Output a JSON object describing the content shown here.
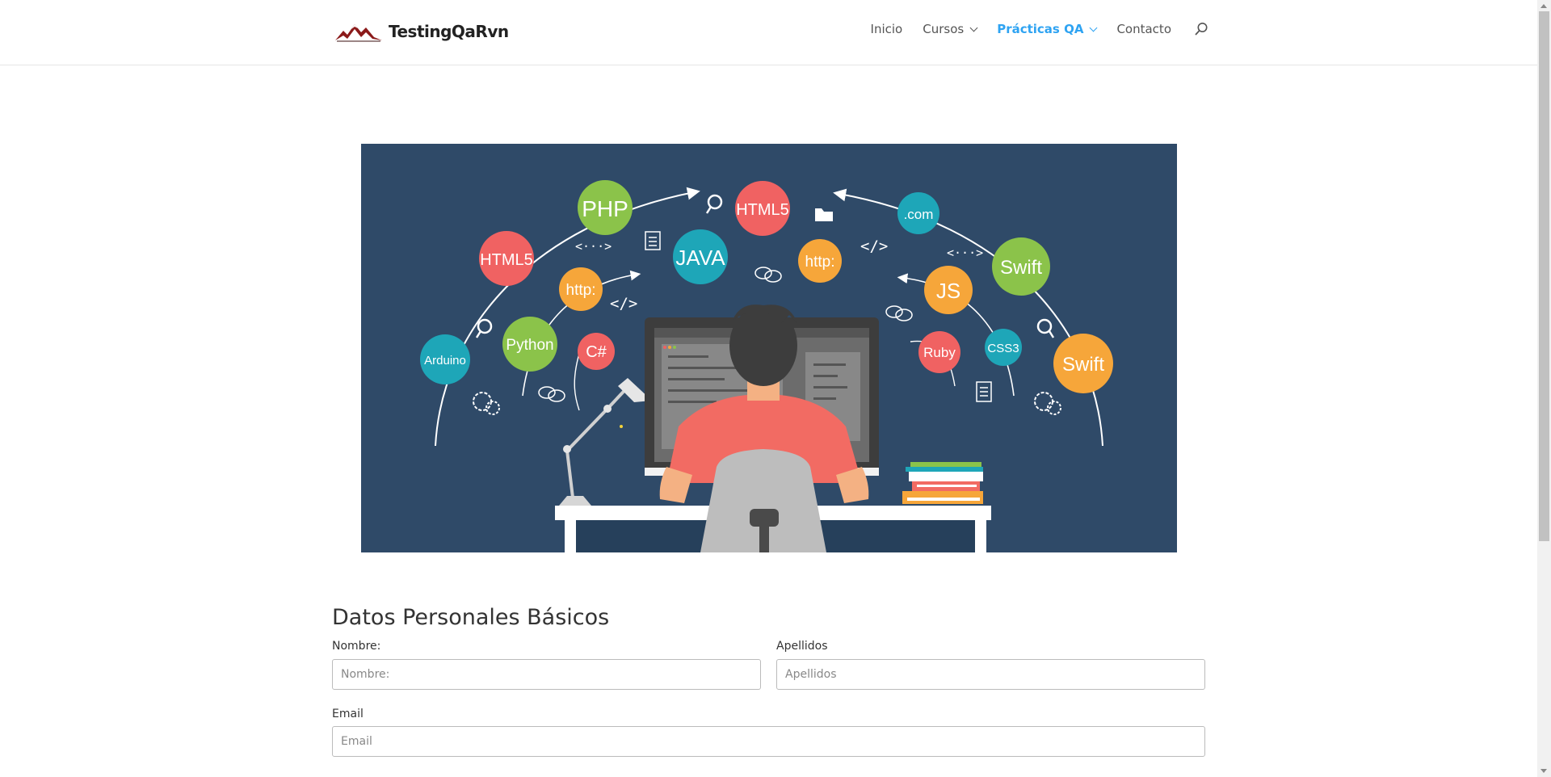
{
  "brand": {
    "name": "TestingQaRvn"
  },
  "nav": {
    "items": [
      {
        "label": "Inicio",
        "dropdown": false,
        "active": false
      },
      {
        "label": "Cursos",
        "dropdown": true,
        "active": false
      },
      {
        "label": "Prácticas QA",
        "dropdown": true,
        "active": true
      },
      {
        "label": "Contacto",
        "dropdown": false,
        "active": false
      }
    ],
    "active_color": "#2ea3f2"
  },
  "hero": {
    "bubbles": [
      "PHP",
      "HTML5",
      "HTML5",
      "JAVA",
      "http:",
      "http:",
      ".com",
      "Swift",
      "Swift",
      "JS",
      "Python",
      "C#",
      "Arduino",
      "Ruby",
      "CSS3"
    ],
    "code_tags": [
      "<···>",
      "</>",
      "</>",
      "<···>"
    ]
  },
  "form": {
    "title": "Datos Personales Básicos",
    "fields": {
      "nombre": {
        "label": "Nombre:",
        "placeholder": "Nombre:",
        "value": ""
      },
      "apellidos": {
        "label": "Apellidos",
        "placeholder": "Apellidos",
        "value": ""
      },
      "email": {
        "label": "Email",
        "placeholder": "Email",
        "value": ""
      }
    }
  }
}
